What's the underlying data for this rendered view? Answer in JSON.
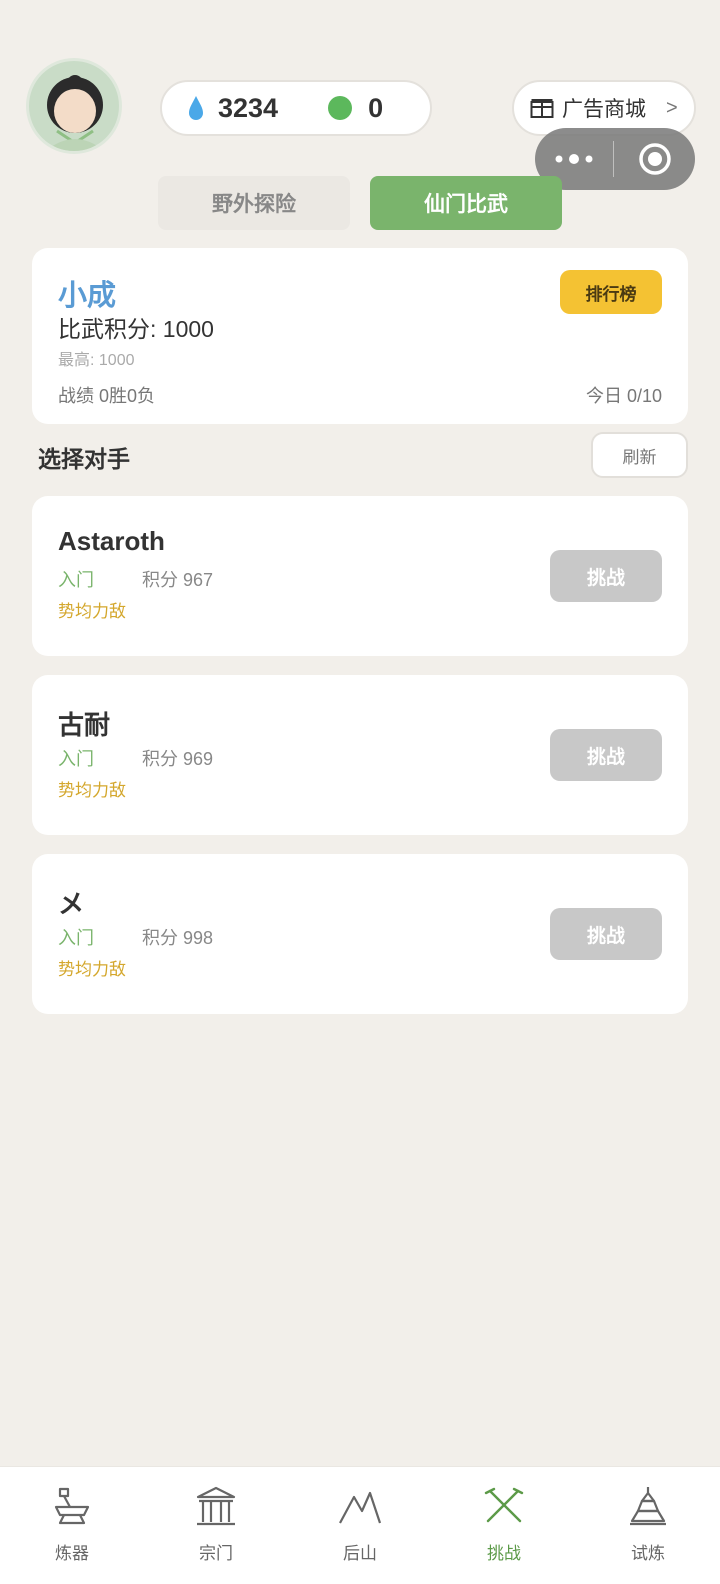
{
  "header": {
    "water_value": "3234",
    "orb_value": "0",
    "shop_label": "广告商城",
    "shop_arrow": ">"
  },
  "tabs": [
    {
      "label": "野外探险",
      "active": false
    },
    {
      "label": "仙门比武",
      "active": true
    }
  ],
  "profile": {
    "name": "小成",
    "score": "比武积分: 1000",
    "best": "最高: 1000",
    "record": "战绩 0胜0负",
    "today": "今日 0/10",
    "rank_button": "排行榜"
  },
  "opponents_section": {
    "title": "选择对手",
    "refresh_label": "刷新"
  },
  "opponents": [
    {
      "name": "Astaroth",
      "rank": "入门",
      "score": "积分 967",
      "tag": "势均力敌",
      "button": "挑战"
    },
    {
      "name": "古耐",
      "rank": "入门",
      "score": "积分 969",
      "tag": "势均力敌",
      "button": "挑战"
    },
    {
      "name": "メ",
      "rank": "入门",
      "score": "积分 998",
      "tag": "势均力敌",
      "button": "挑战"
    }
  ],
  "bottom_nav": [
    {
      "label": "炼器",
      "icon": "forge-icon",
      "active": false
    },
    {
      "label": "宗门",
      "icon": "temple-icon",
      "active": false
    },
    {
      "label": "后山",
      "icon": "mountain-icon",
      "active": false
    },
    {
      "label": "挑战",
      "icon": "crossed-swords-icon",
      "active": true
    },
    {
      "label": "试炼",
      "icon": "pagoda-icon",
      "active": false
    }
  ],
  "colors": {
    "background": "#f2efea",
    "accent_green": "#7ab46c",
    "name_blue": "#5a9bd4",
    "rank_yellow": "#f4c233",
    "tag_gold": "#d4a72c",
    "disabled_gray": "#c8c8c8"
  }
}
